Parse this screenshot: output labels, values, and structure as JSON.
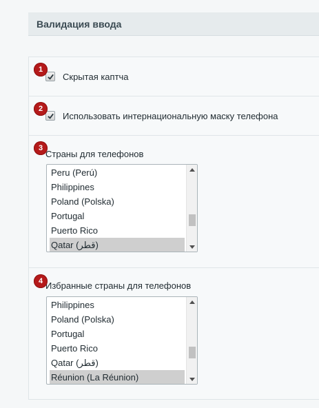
{
  "section": {
    "title": "Валидация ввода"
  },
  "badges": [
    "1",
    "2",
    "3",
    "4"
  ],
  "hidden_captcha": {
    "label": "Скрытая каптча",
    "checked": true
  },
  "intl_phone_mask": {
    "label": "Использовать интернациональную маску телефона",
    "checked": true
  },
  "phone_countries": {
    "label": "Страны для телефонов",
    "options": [
      "Peru (Perú)",
      "Philippines",
      "Poland (Polska)",
      "Portugal",
      "Puerto Rico",
      "Qatar (‫قطر‬‎)"
    ],
    "selected": "Qatar (‫قطر‬‎)"
  },
  "favorite_countries": {
    "label": "Избранные страны для телефонов",
    "options": [
      "Philippines",
      "Poland (Polska)",
      "Portugal",
      "Puerto Rico",
      "Qatar (‫قطر‬‎)",
      "Réunion (La Réunion)"
    ],
    "selected": "Réunion (La Réunion)"
  },
  "colors": {
    "badge": "#b51a1a",
    "selected_option": "#cfcfcf",
    "header_bg": "#e6ebed"
  }
}
